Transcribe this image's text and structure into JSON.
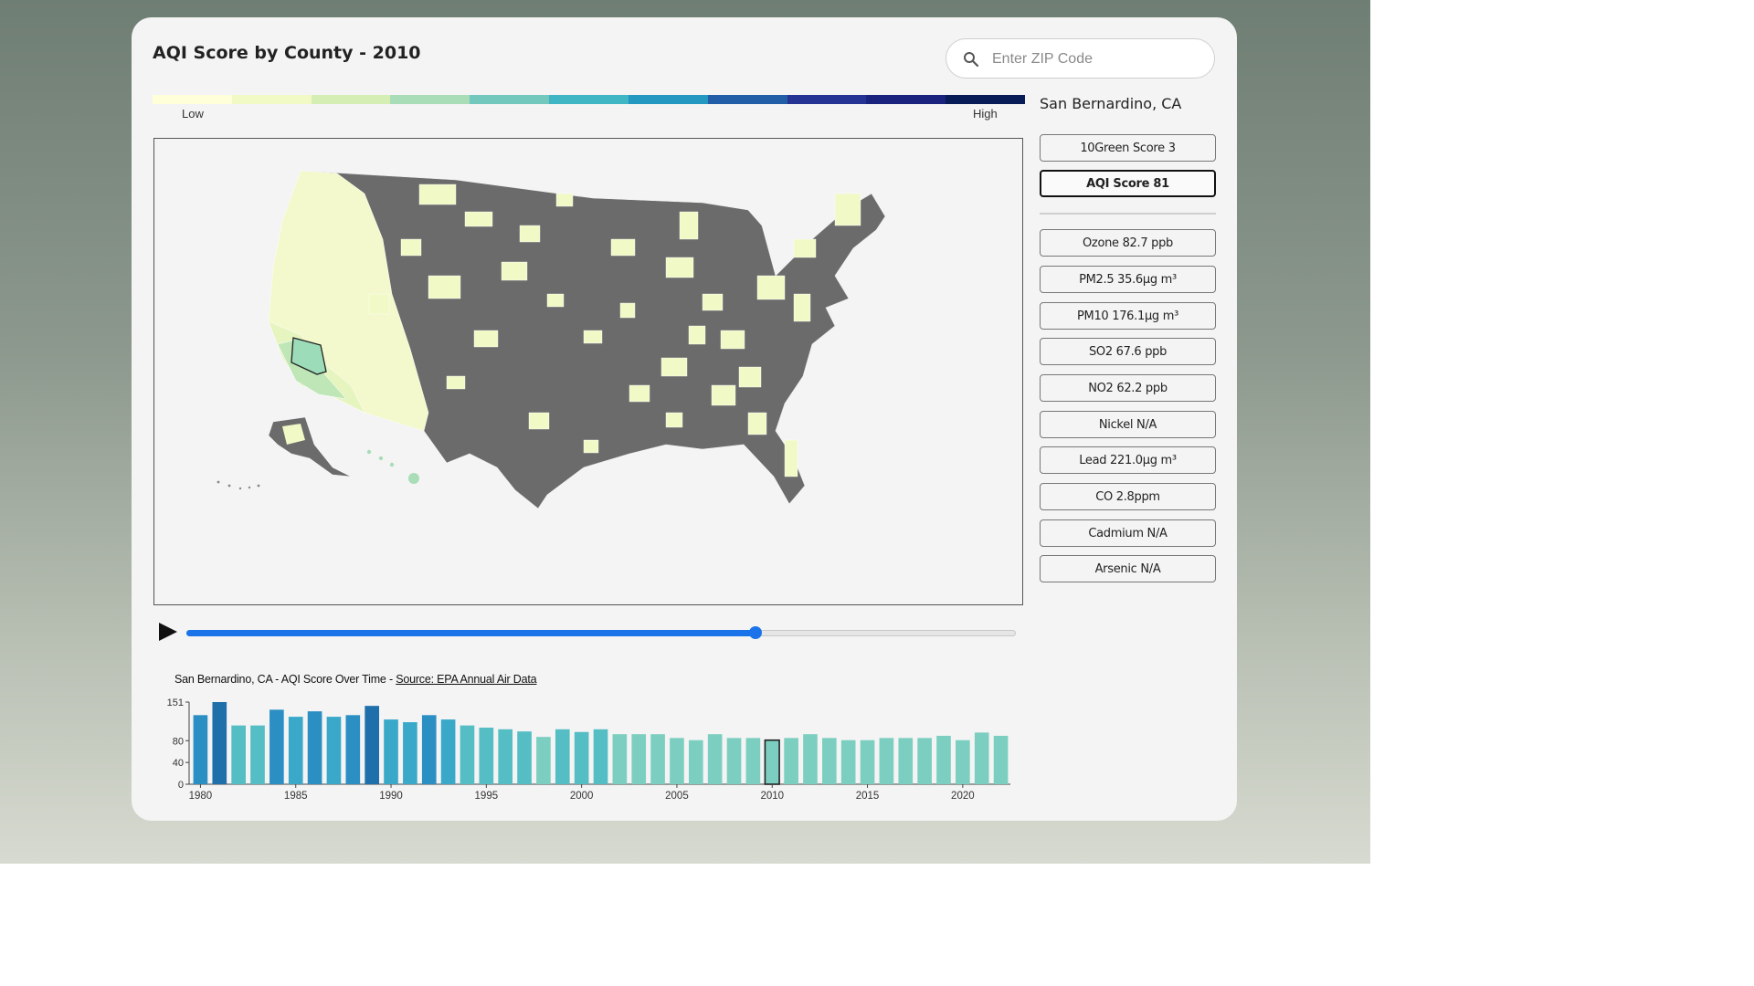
{
  "header": {
    "title": "AQI Score by County - 2010"
  },
  "search": {
    "placeholder": "Enter ZIP Code",
    "icon": "search-icon"
  },
  "legend": {
    "low_label": "Low",
    "high_label": "High",
    "colors": [
      "#ffffd9",
      "#f1f9c4",
      "#d5eeb3",
      "#a9ddb7",
      "#73c8bd",
      "#40b5c4",
      "#2498c1",
      "#225ea8",
      "#253494",
      "#1a237e",
      "#081d58"
    ]
  },
  "map": {
    "selected_county": "San Bernardino, CA",
    "no_data_color": "#6b6b6b"
  },
  "sidebar": {
    "location": "San Bernardino, CA",
    "primary": [
      {
        "label": "10Green Score 3",
        "active": false
      },
      {
        "label": "AQI Score 81",
        "active": true
      }
    ],
    "metrics": [
      {
        "label": "Ozone 82.7 ppb"
      },
      {
        "label": "PM2.5 35.6µg m³"
      },
      {
        "label": "PM10 176.1µg m³"
      },
      {
        "label": "SO2 67.6 ppb"
      },
      {
        "label": "NO2 62.2 ppb"
      },
      {
        "label": "Nickel N/A"
      },
      {
        "label": "Lead 221.0µg m³"
      },
      {
        "label": "CO 2.8ppm"
      },
      {
        "label": "Cadmium N/A"
      },
      {
        "label": "Arsenic N/A"
      }
    ]
  },
  "timeline": {
    "min_year": 1980,
    "max_year": 2021,
    "selected_year": 2010,
    "play_icon": "play-icon"
  },
  "chart_caption": {
    "prefix": "San Bernardino, CA - AQI Score Over Time - ",
    "source": "Source: EPA Annual Air Data"
  },
  "chart_data": {
    "type": "bar",
    "x": [
      1980,
      1981,
      1982,
      1983,
      1984,
      1985,
      1986,
      1987,
      1988,
      1989,
      1990,
      1991,
      1992,
      1993,
      1994,
      1995,
      1996,
      1997,
      1998,
      1999,
      2000,
      2001,
      2002,
      2003,
      2004,
      2005,
      2006,
      2007,
      2008,
      2009,
      2010,
      2011,
      2012,
      2013,
      2014,
      2015,
      2016,
      2017,
      2018,
      2019,
      2020,
      2021
    ],
    "values": [
      127,
      151,
      108,
      108,
      137,
      124,
      134,
      124,
      127,
      144,
      119,
      114,
      127,
      119,
      108,
      104,
      101,
      97,
      87,
      101,
      96,
      101,
      92,
      92,
      92,
      85,
      81,
      92,
      85,
      85,
      81,
      85,
      92,
      85,
      81,
      81,
      85,
      85,
      85,
      89,
      81,
      95,
      89
    ],
    "highlight_year": 2010,
    "yticks": [
      0,
      40,
      80,
      151
    ],
    "xticks": [
      1980,
      1985,
      1990,
      1995,
      2000,
      2005,
      2010,
      2015,
      2020
    ],
    "ylim": [
      0,
      151
    ]
  }
}
